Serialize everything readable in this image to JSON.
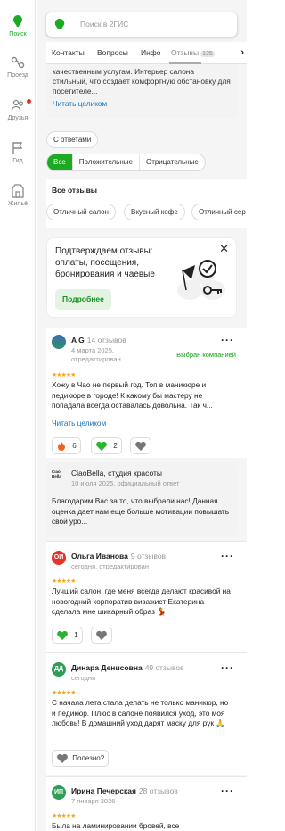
{
  "sidebar": {
    "items": [
      {
        "label": "Поиск",
        "icon": "pin-icon"
      },
      {
        "label": "Проезд",
        "icon": "route-icon"
      },
      {
        "label": "Друзья",
        "icon": "friends-icon"
      },
      {
        "label": "Гид",
        "icon": "flag-icon"
      },
      {
        "label": "Жильё",
        "icon": "home-icon"
      }
    ]
  },
  "search": {
    "placeholder": "Поиск в 2ГИС"
  },
  "tabs": [
    {
      "label": "Контакты"
    },
    {
      "label": "Вопросы"
    },
    {
      "label": "Инфо"
    },
    {
      "label": "Отзывы",
      "count": "135"
    }
  ],
  "description": {
    "text": "качественным услугам. Интерьер салона стильный, что создаёт комфортную обстановку для посетителе...",
    "read_more": "Читать целиком"
  },
  "filters": {
    "with_answers": "С ответами",
    "segments": [
      "Все",
      "Положительные",
      "Отрицательные"
    ],
    "all_reviews_title": "Все отзывы",
    "tags": [
      "Отличный салон",
      "Вкусный кофе",
      "Отличный сер"
    ]
  },
  "promo": {
    "text": "Подтверждаем отзывы: оплаты, посещения, бронирования и чаевые",
    "button": "Подробнее"
  },
  "reviews": [
    {
      "initials": "",
      "name": "A G",
      "count": "14 отзывов",
      "date_line1": "4 марта 2025,",
      "date_line2": "отредактирован",
      "selected": "Выбран компанией",
      "stars": "★★★★★",
      "text": "Хожу в Чао не первый год. Топ в маникюре и педикюре в городе! К какому бы мастеру не попадала всегда оставалась довольна. Так ч...",
      "read_more": "Читать целиком",
      "reactions": [
        {
          "emoji": "fire-icon",
          "count": "6"
        },
        {
          "emoji": "heart-green-icon",
          "count": "2"
        },
        {
          "emoji": "heart-outline-icon",
          "count": ""
        }
      ]
    },
    {
      "initials": "ОИ",
      "name": "Ольга Иванова",
      "count": "9 отзывов",
      "date_line1": "сегодня, отредактирован",
      "stars": "★★★★★",
      "text": "Лучший салон, где меня всегда делают красивой на новогодний корпоратив визажист Екатерина сделала мне шикарный образ 💃",
      "reactions": [
        {
          "emoji": "heart-green-icon",
          "count": "1"
        },
        {
          "emoji": "heart-outline-icon",
          "count": ""
        }
      ]
    },
    {
      "initials": "ДД",
      "name": "Динара Денисовна",
      "count": "49 отзывов",
      "date_line1": "сегодня",
      "stars": "★★★★★",
      "text": "С начала лета стала делать не только маникюр, но и педикюр. Плюс в салоне появился уход, это моя любовь! В домашний уход дарят маску для рук 🙏",
      "useful": "Полезно?"
    },
    {
      "initials": "ИП",
      "name": "Ирина Печерская",
      "count": "28 отзывов",
      "date_line1": "7 января 2026",
      "stars": "★★★★★",
      "text": "Была на ламинировании бровей, все"
    }
  ],
  "reply": {
    "logo": "Ciao Bella",
    "name": "CiaoBella, студия красоты",
    "date": "10 июля 2025, официальный ответ",
    "text": "Благодарим Вас за то, что выбрали нас! Данная оценка дает нам еще больше мотивации повышать свой уро..."
  },
  "colors": {
    "accent": "#1baa21",
    "link": "#1a73b8",
    "star": "#f5a623"
  }
}
